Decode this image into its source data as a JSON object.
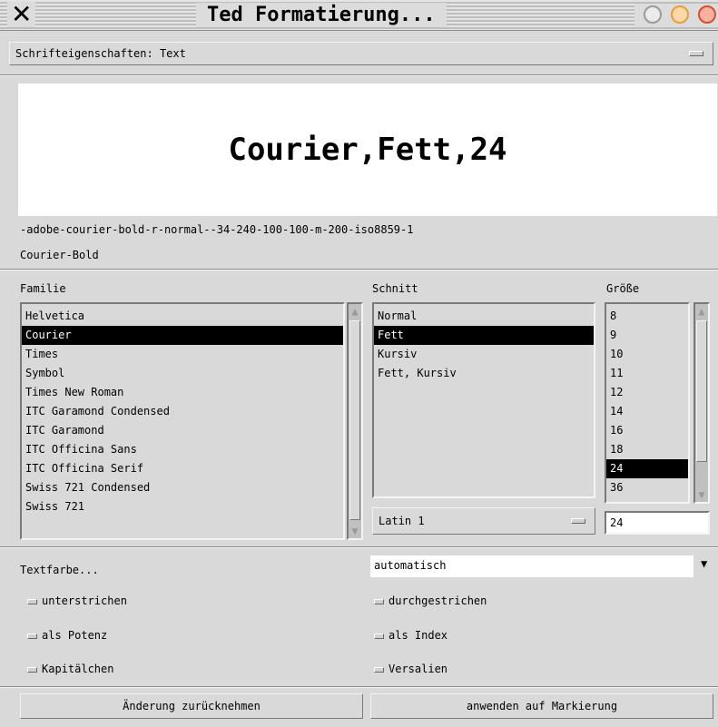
{
  "window": {
    "title": "Ted Formatierung...",
    "icons": {
      "app": "x-logo-icon",
      "minimize": "minimize-icon",
      "maximize": "maximize-icon",
      "close": "close-icon"
    }
  },
  "font_properties_menu": {
    "selected": "Schrifteigenschaften: Text"
  },
  "preview": {
    "sample_text": "Courier,Fett,24",
    "xlfd_name": "-adobe-courier-bold-r-normal--34-240-100-100-m-200-iso8859-1",
    "ps_name": "Courier-Bold"
  },
  "family": {
    "label": "Familie",
    "items": [
      "Helvetica",
      "Courier",
      "Times",
      "Symbol",
      "Times New Roman",
      "ITC Garamond Condensed",
      "ITC Garamond",
      "ITC Officina Sans",
      "ITC Officina Serif",
      "Swiss 721 Condensed",
      "Swiss 721"
    ],
    "selected_index": 1
  },
  "style": {
    "label": "Schnitt",
    "items": [
      "Normal",
      "Fett",
      "Kursiv",
      "Fett, Kursiv"
    ],
    "selected_index": 1,
    "encoding": "Latin 1"
  },
  "size": {
    "label": "Größe",
    "items": [
      "8",
      "9",
      "10",
      "11",
      "12",
      "14",
      "16",
      "18",
      "24",
      "36"
    ],
    "selected_index": 8,
    "entry_value": "24"
  },
  "text_color": {
    "button_label": "Textfarbe...",
    "value": "automatisch"
  },
  "checkboxes": {
    "underline": "unterstrichen",
    "strikethrough": "durchgestrichen",
    "superscript": "als Potenz",
    "subscript": "als Index",
    "small_caps": "Kapitälchen",
    "all_caps": "Versalien"
  },
  "buttons": {
    "revert": "Änderung zurücknehmen",
    "apply": "anwenden auf Markierung"
  }
}
